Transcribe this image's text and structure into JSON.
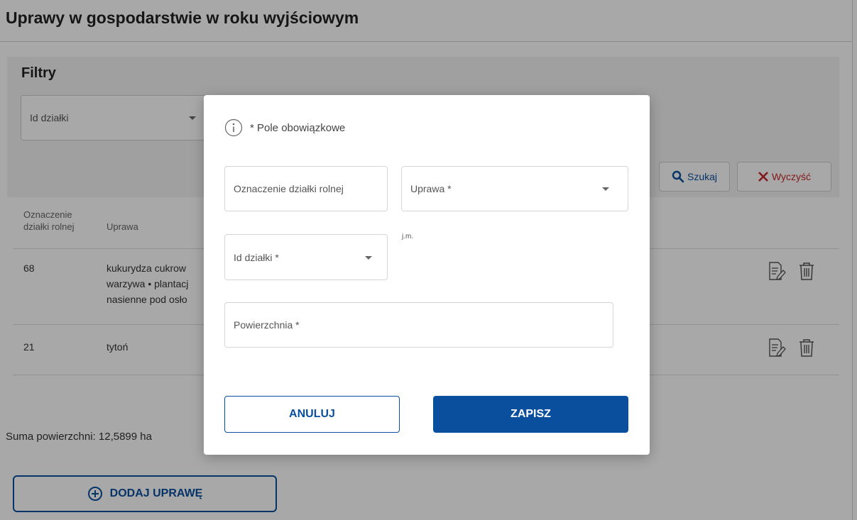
{
  "page": {
    "title": "Uprawy w gospodarstwie w roku wyjściowym"
  },
  "filters": {
    "title": "Filtry",
    "id_dzialki_label": "Id działki",
    "search_label": "Szukaj",
    "clear_label": "Wyczyść"
  },
  "table": {
    "headers": {
      "oznaczenie_line1": "Oznaczenie",
      "oznaczenie_line2": "działki rolnej",
      "uprawa": "Uprawa"
    },
    "rows": [
      {
        "oznaczenie": "68",
        "uprawa_lines": [
          "kukurydza cukrow",
          "warzywa • plantacj",
          "nasienne pod osło"
        ]
      },
      {
        "oznaczenie": "21",
        "uprawa_lines": [
          "tytoń"
        ]
      }
    ]
  },
  "summary": {
    "text": "Suma powierzchni: 12,5899 ha"
  },
  "add_button": {
    "label": "DODAJ UPRAWĘ"
  },
  "modal": {
    "info_text": "* Pole obowiązkowe",
    "fields": {
      "oznaczenie_label": "Oznaczenie działki rolnej",
      "uprawa_label": "Uprawa *",
      "id_dzialki_label": "Id działki *",
      "jm_label": "j.m.",
      "powierzchnia_label": "Powierzchnia *"
    },
    "cancel_label": "ANULUJ",
    "save_label": "ZAPISZ"
  },
  "colors": {
    "primary": "#0a4f9e",
    "danger": "#c62828",
    "overlay": "rgba(0,0,0,0.34)"
  },
  "icons": [
    "search-icon",
    "close-icon",
    "edit-icon",
    "trash-icon",
    "plus-circle-icon",
    "info-icon",
    "chevron-down-icon"
  ]
}
